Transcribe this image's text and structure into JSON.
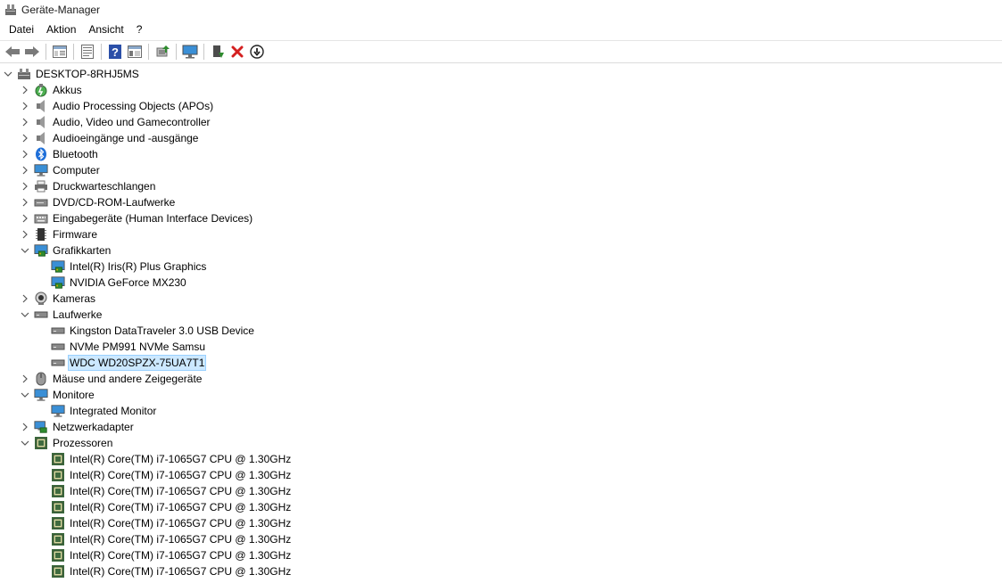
{
  "window": {
    "title": "Geräte-Manager"
  },
  "menu": [
    "Datei",
    "Aktion",
    "Ansicht",
    "?"
  ],
  "toolbar": {
    "icons": [
      "back-arrow-icon",
      "forward-arrow-icon",
      "show-hide-tree-icon",
      "properties-icon",
      "help-icon",
      "details-pane-icon",
      "update-driver-icon",
      "scan-hardware-icon",
      "enable-device-icon",
      "uninstall-device-icon",
      "download-icon"
    ],
    "colors": {
      "uninstall": "#d42020",
      "enable": "#2e8b2e"
    }
  },
  "tree": {
    "root": "DESKTOP-8RHJ5MS",
    "categories": [
      {
        "label": "Akkus",
        "icon": "battery-icon",
        "expanded": false,
        "children": []
      },
      {
        "label": "Audio Processing Objects (APOs)",
        "icon": "speaker-icon",
        "expanded": false,
        "children": []
      },
      {
        "label": "Audio, Video und Gamecontroller",
        "icon": "speaker-icon",
        "expanded": false,
        "children": []
      },
      {
        "label": "Audioeingänge und -ausgänge",
        "icon": "speaker-icon",
        "expanded": false,
        "children": []
      },
      {
        "label": "Bluetooth",
        "icon": "bluetooth-icon",
        "expanded": false,
        "children": []
      },
      {
        "label": "Computer",
        "icon": "computer-icon",
        "expanded": false,
        "children": []
      },
      {
        "label": "Druckwarteschlangen",
        "icon": "printer-icon",
        "expanded": false,
        "children": []
      },
      {
        "label": "DVD/CD-ROM-Laufwerke",
        "icon": "optical-drive-icon",
        "expanded": false,
        "children": []
      },
      {
        "label": "Eingabegeräte (Human Interface Devices)",
        "icon": "keyboard-icon",
        "expanded": false,
        "children": []
      },
      {
        "label": "Firmware",
        "icon": "firmware-chip-icon",
        "expanded": false,
        "children": []
      },
      {
        "label": "Grafikkarten",
        "icon": "display-adapter-icon",
        "expanded": true,
        "children": [
          "Intel(R) Iris(R) Plus Graphics",
          "NVIDIA GeForce MX230"
        ]
      },
      {
        "label": "Kameras",
        "icon": "camera-icon",
        "expanded": false,
        "children": []
      },
      {
        "label": "Laufwerke",
        "icon": "disk-drive-icon",
        "expanded": true,
        "children": [
          "Kingston DataTraveler 3.0 USB Device",
          "NVMe PM991 NVMe Samsu",
          "WDC WD20SPZX-75UA7T1"
        ]
      },
      {
        "label": "Mäuse und andere Zeigegeräte",
        "icon": "mouse-icon",
        "expanded": false,
        "children": []
      },
      {
        "label": "Monitore",
        "icon": "monitor-icon",
        "expanded": true,
        "children": [
          "Integrated Monitor"
        ]
      },
      {
        "label": "Netzwerkadapter",
        "icon": "network-adapter-icon",
        "expanded": false,
        "children": []
      },
      {
        "label": "Prozessoren",
        "icon": "processor-icon",
        "expanded": true,
        "children": [
          "Intel(R) Core(TM) i7-1065G7 CPU @ 1.30GHz",
          "Intel(R) Core(TM) i7-1065G7 CPU @ 1.30GHz",
          "Intel(R) Core(TM) i7-1065G7 CPU @ 1.30GHz",
          "Intel(R) Core(TM) i7-1065G7 CPU @ 1.30GHz",
          "Intel(R) Core(TM) i7-1065G7 CPU @ 1.30GHz",
          "Intel(R) Core(TM) i7-1065G7 CPU @ 1.30GHz",
          "Intel(R) Core(TM) i7-1065G7 CPU @ 1.30GHz",
          "Intel(R) Core(TM) i7-1065G7 CPU @ 1.30GHz"
        ]
      }
    ],
    "selected": "WDC WD20SPZX-75UA7T1",
    "colors": {
      "selection_bg": "#cce8ff",
      "selection_border": "#99d1ff"
    }
  }
}
